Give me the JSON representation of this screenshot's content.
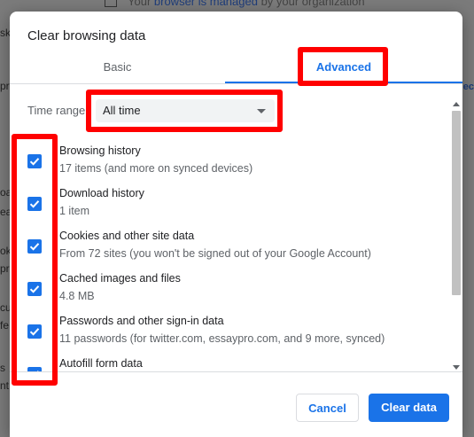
{
  "background": {
    "banner": {
      "pre": "Your ",
      "link": "browser is managed",
      "post": " by your organization"
    },
    "left_fragments": [
      "sk",
      "pro",
      "oar",
      "ear",
      "ok",
      "pro",
      "cu",
      "fe",
      "s",
      "nt"
    ],
    "right_fragment": "ec"
  },
  "dialog": {
    "title": "Clear browsing data",
    "tabs": {
      "basic": "Basic",
      "advanced": "Advanced"
    },
    "time_range": {
      "label": "Time range",
      "value": "All time"
    },
    "items": [
      {
        "title": "Browsing history",
        "desc": "17 items (and more on synced devices)",
        "checked": true
      },
      {
        "title": "Download history",
        "desc": "1 item",
        "checked": true
      },
      {
        "title": "Cookies and other site data",
        "desc": "From 72 sites (you won't be signed out of your Google Account)",
        "checked": true
      },
      {
        "title": "Cached images and files",
        "desc": "4.8 MB",
        "checked": true
      },
      {
        "title": "Passwords and other sign-in data",
        "desc": "11 passwords (for twitter.com, essaypro.com, and 9 more, synced)",
        "checked": true
      },
      {
        "title": "Autofill form data",
        "desc": "",
        "checked": true
      }
    ],
    "buttons": {
      "cancel": "Cancel",
      "clear": "Clear data"
    }
  },
  "colors": {
    "accent": "#1a73e8",
    "highlight": "#ff0000"
  }
}
